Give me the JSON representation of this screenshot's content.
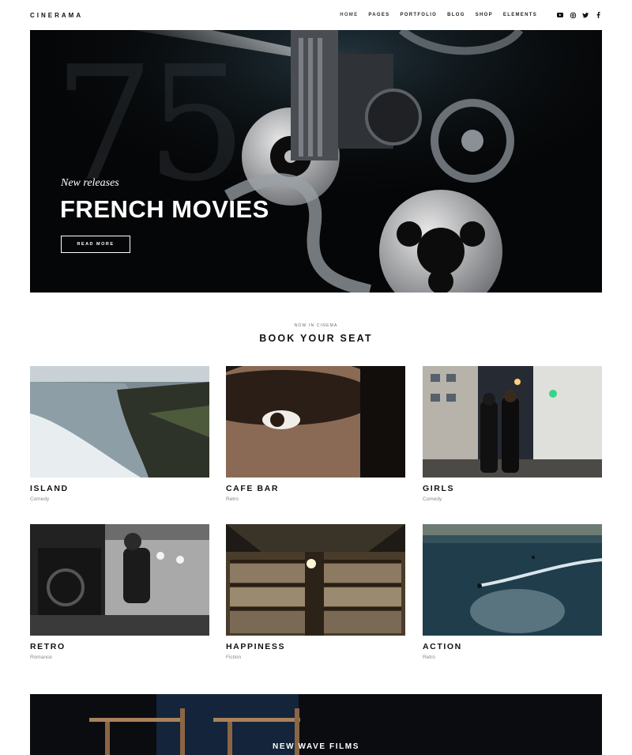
{
  "header": {
    "logo": "CINERAMA",
    "nav": [
      {
        "label": "HOME",
        "active": true
      },
      {
        "label": "PAGES"
      },
      {
        "label": "PORTFOLIO"
      },
      {
        "label": "BLOG"
      },
      {
        "label": "SHOP"
      },
      {
        "label": "ELEMENTS"
      }
    ],
    "social": [
      "youtube-icon",
      "instagram-icon",
      "twitter-icon",
      "facebook-icon"
    ]
  },
  "hero": {
    "number": "75",
    "subtitle": "New releases",
    "title": "FRENCH MOVIES",
    "button": "READ MORE"
  },
  "section": {
    "eyebrow": "NOW IN CINEMA",
    "title": "BOOK YOUR SEAT"
  },
  "movies": [
    {
      "title": "ISLAND",
      "genre": "Comedy"
    },
    {
      "title": "CAFE BAR",
      "genre": "Retro"
    },
    {
      "title": "GIRLS",
      "genre": "Comedy"
    },
    {
      "title": "RETRO",
      "genre": "Romance"
    },
    {
      "title": "HAPPINESS",
      "genre": "Fiction"
    },
    {
      "title": "ACTION",
      "genre": "Retro"
    }
  ],
  "banner": {
    "title": "NEW WAVE FILMS"
  },
  "colors": {
    "background": "#ffffff",
    "text": "#111111",
    "hero_bg": "#050607",
    "muted": "#888888"
  }
}
